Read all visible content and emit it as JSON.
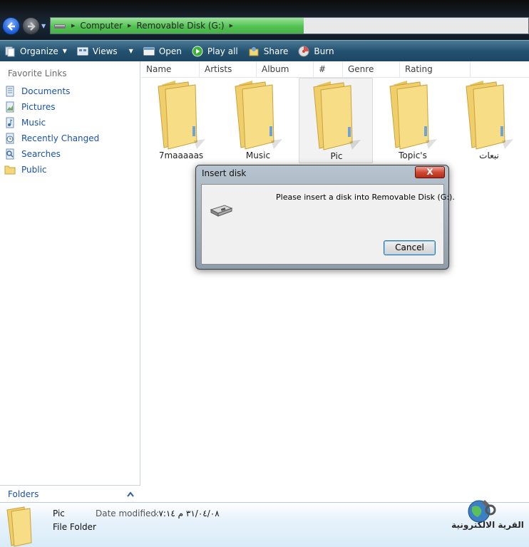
{
  "address": {
    "breadcrumbs": [
      "Computer",
      "Removable Disk (G:)"
    ],
    "progress": 0.53
  },
  "toolbar": {
    "items": [
      {
        "label": "Organize",
        "icon": "organize-icon",
        "has_dropdown": true
      },
      {
        "label": "Views",
        "icon": "views-icon",
        "has_dropdown": true
      },
      {
        "label": "Open",
        "icon": "open-icon",
        "has_dropdown": false
      },
      {
        "label": "Play all",
        "icon": "play-icon",
        "has_dropdown": false
      },
      {
        "label": "Share",
        "icon": "share-icon",
        "has_dropdown": false
      },
      {
        "label": "Burn",
        "icon": "burn-icon",
        "has_dropdown": false
      }
    ]
  },
  "sidebar": {
    "title": "Favorite Links",
    "items": [
      {
        "label": "Documents",
        "icon": "documents-icon"
      },
      {
        "label": "Pictures",
        "icon": "pictures-icon"
      },
      {
        "label": "Music",
        "icon": "music-icon"
      },
      {
        "label": "Recently Changed",
        "icon": "recently-changed-icon"
      },
      {
        "label": "Searches",
        "icon": "searches-icon"
      },
      {
        "label": "Public",
        "icon": "public-folder-icon"
      }
    ],
    "folders_label": "Folders"
  },
  "columns": [
    "Name",
    "Artists",
    "Album",
    "#",
    "Genre",
    "Rating"
  ],
  "folders": [
    {
      "name": "7maaaaas",
      "selected": false
    },
    {
      "name": "Music",
      "selected": false
    },
    {
      "name": "Pic",
      "selected": true
    },
    {
      "name": "Topic's",
      "selected": false
    },
    {
      "name": "نبعات",
      "selected": false
    }
  ],
  "dialog": {
    "title": "Insert disk",
    "close_label": "X",
    "message": "Please insert a disk into Removable Disk (G:).",
    "cancel_label": "Cancel"
  },
  "details": {
    "name": "Pic",
    "type": "File Folder",
    "date_label": "Date modified:",
    "date_value": "٣١/٠٤/٠٨ م ٠٧:١٤"
  },
  "watermark": {
    "text": "القرية الالكترونية"
  },
  "colors": {
    "toolbar": "#245271",
    "link": "#1a51a8",
    "progress": "#52c352",
    "folder": "#f3d77a"
  }
}
